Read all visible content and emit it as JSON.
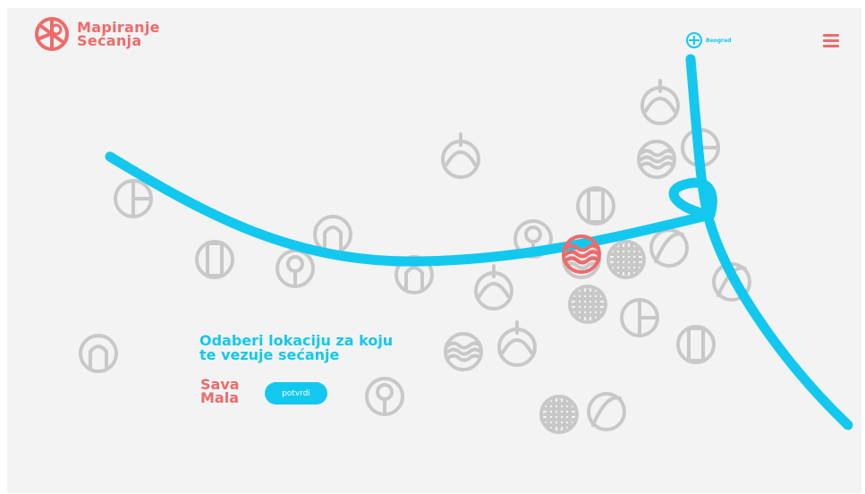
{
  "brand": {
    "line1": "Mapiranje",
    "line2": "Sećanja"
  },
  "header": {
    "city_label": "Beograd"
  },
  "prompt": {
    "line1": "Odaberi lokaciju za koju",
    "line2": "te vezuje sećanje"
  },
  "selection": {
    "line1": "Sava",
    "line2": "Mala"
  },
  "confirm_label": "potvrdi",
  "colors": {
    "accent": "#ef6a6a",
    "river": "#13c8ef",
    "landmark": "#c8c8c8",
    "background": "#f3f3f3"
  },
  "landmarks": [
    {
      "name": "church-dome-icon",
      "shape": "dome"
    },
    {
      "name": "pergola-icon",
      "shape": "waves"
    },
    {
      "name": "fortress-icon",
      "shape": "half"
    },
    {
      "name": "arch-building-icon",
      "shape": "tower"
    },
    {
      "name": "dome-building-icon",
      "shape": "arch"
    },
    {
      "name": "park-tree-icon",
      "shape": "tree"
    },
    {
      "name": "bridge-icon",
      "shape": "grid"
    },
    {
      "name": "tower-icon",
      "shape": "dome"
    },
    {
      "name": "monument-icon",
      "shape": "leaf"
    },
    {
      "name": "sava-mala-icon",
      "shape": "waves",
      "selected": true
    }
  ]
}
